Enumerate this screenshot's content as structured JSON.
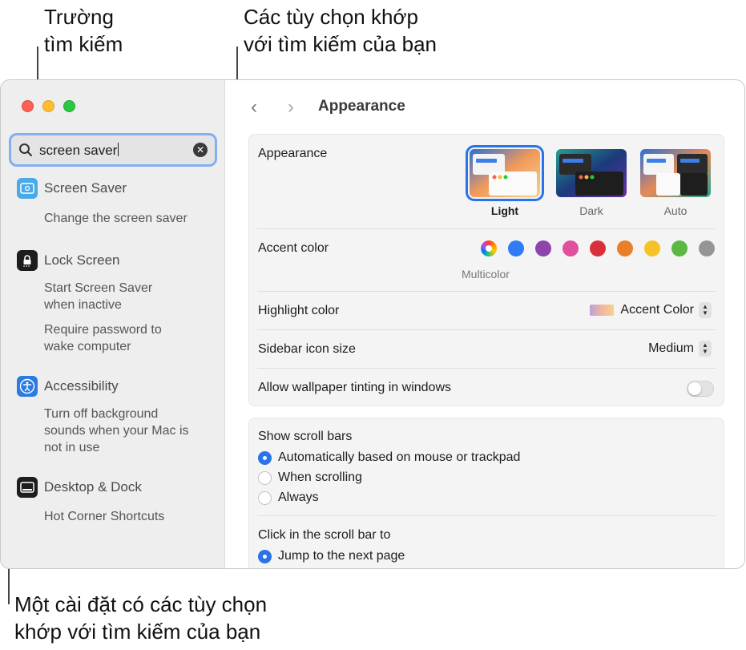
{
  "callouts": {
    "search_field": "Trường\ntìm kiếm",
    "matching_options": "Các tùy chọn khớp\nvới tìm kiếm của bạn",
    "setting_with_matches": "Một cài đặt có các tùy chọn\nkhớp với tìm kiếm của bạn"
  },
  "search": {
    "value": "screen saver"
  },
  "sidebar": {
    "screen_saver": {
      "title": "Screen Saver",
      "subs": [
        "Change the screen saver"
      ]
    },
    "lock_screen": {
      "title": "Lock Screen",
      "subs": [
        "Start Screen Saver\nwhen inactive",
        "Require password to\nwake computer"
      ]
    },
    "accessibility": {
      "title": "Accessibility",
      "subs": [
        "Turn off background\nsounds when your Mac is\nnot in use"
      ]
    },
    "desktop_dock": {
      "title": "Desktop & Dock",
      "subs": [
        "Hot Corner Shortcuts"
      ]
    }
  },
  "header": {
    "back": "‹",
    "forward": "›",
    "title": "Appearance"
  },
  "appearance": {
    "label": "Appearance",
    "options": [
      {
        "name": "Light",
        "selected": true
      },
      {
        "name": "Dark",
        "selected": false
      },
      {
        "name": "Auto",
        "selected": false
      }
    ]
  },
  "accent": {
    "label": "Accent color",
    "multicolor_label": "Multicolor",
    "colors": [
      "#2f7cf6",
      "#8e44ad",
      "#e0509e",
      "#d8303a",
      "#ea7f2a",
      "#f6c327",
      "#5cb844",
      "#959595"
    ]
  },
  "highlight": {
    "label": "Highlight color",
    "value": "Accent Color"
  },
  "sidebar_icon_size": {
    "label": "Sidebar icon size",
    "value": "Medium"
  },
  "wallpaper_tinting": {
    "label": "Allow wallpaper tinting in windows",
    "on": false
  },
  "scroll_bars": {
    "label": "Show scroll bars",
    "options": [
      {
        "label": "Automatically based on mouse or trackpad",
        "selected": true
      },
      {
        "label": "When scrolling",
        "selected": false
      },
      {
        "label": "Always",
        "selected": false
      }
    ]
  },
  "click_scroll": {
    "label": "Click in the scroll bar to",
    "options": [
      {
        "label": "Jump to the next page",
        "selected": true
      }
    ]
  }
}
